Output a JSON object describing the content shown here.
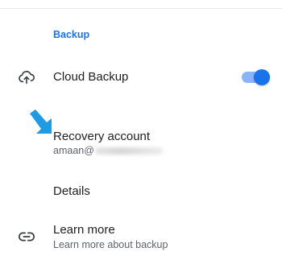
{
  "section": {
    "header": "Backup"
  },
  "cloud_backup": {
    "label": "Cloud Backup",
    "icon": "cloud-upload-icon",
    "toggle_state": "on"
  },
  "recovery": {
    "label": "Recovery account",
    "account_visible": "amaan@"
  },
  "details": {
    "label": "Details"
  },
  "learn_more": {
    "label": "Learn more",
    "subtitle": "Learn more about backup",
    "icon": "link-icon"
  },
  "colors": {
    "accent": "#1a73e8",
    "toggle_track": "#8ab4f8",
    "annotation_arrow": "#1e9be2",
    "title_text": "#202124",
    "subtitle_text": "#5f6368"
  }
}
